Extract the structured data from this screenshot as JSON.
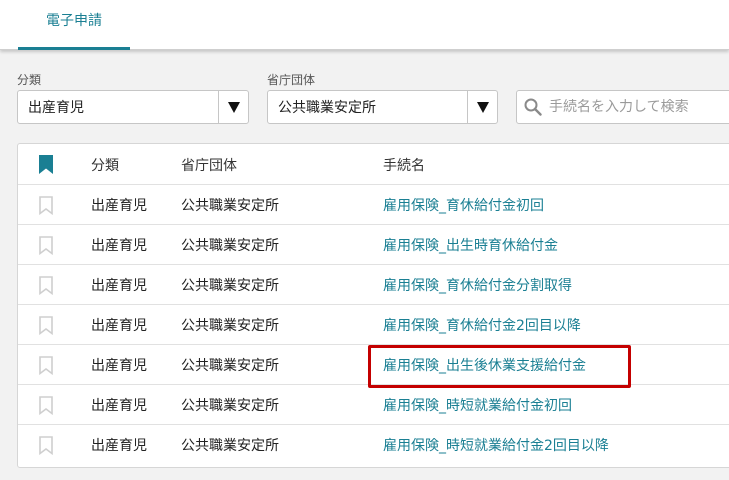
{
  "tabs": [
    {
      "label": "電子申請"
    }
  ],
  "filters": {
    "category": {
      "label": "分類",
      "value": "出産育児"
    },
    "agency": {
      "label": "省庁団体",
      "value": "公共職業安定所"
    },
    "search": {
      "placeholder": "手続名を入力して検索"
    }
  },
  "table": {
    "headers": {
      "category": "分類",
      "agency": "省庁団体",
      "procedure": "手続名"
    },
    "rows": [
      {
        "category": "出産育児",
        "agency": "公共職業安定所",
        "procedure": "雇用保険_育休給付金初回"
      },
      {
        "category": "出産育児",
        "agency": "公共職業安定所",
        "procedure": "雇用保険_出生時育休給付金"
      },
      {
        "category": "出産育児",
        "agency": "公共職業安定所",
        "procedure": "雇用保険_育休給付金分割取得"
      },
      {
        "category": "出産育児",
        "agency": "公共職業安定所",
        "procedure": "雇用保険_育休給付金2回目以降"
      },
      {
        "category": "出産育児",
        "agency": "公共職業安定所",
        "procedure": "雇用保険_出生後休業支援給付金"
      },
      {
        "category": "出産育児",
        "agency": "公共職業安定所",
        "procedure": "雇用保険_時短就業給付金初回"
      },
      {
        "category": "出産育児",
        "agency": "公共職業安定所",
        "procedure": "雇用保険_時短就業給付金2回目以降"
      }
    ]
  },
  "colors": {
    "accent": "#1a7f93",
    "highlight": "#c40000"
  },
  "icons": {
    "bookmark_header": "bookmark-filled-icon",
    "bookmark_row": "bookmark-outline-icon",
    "dropdown": "triangle-down-icon",
    "search": "search-icon"
  }
}
